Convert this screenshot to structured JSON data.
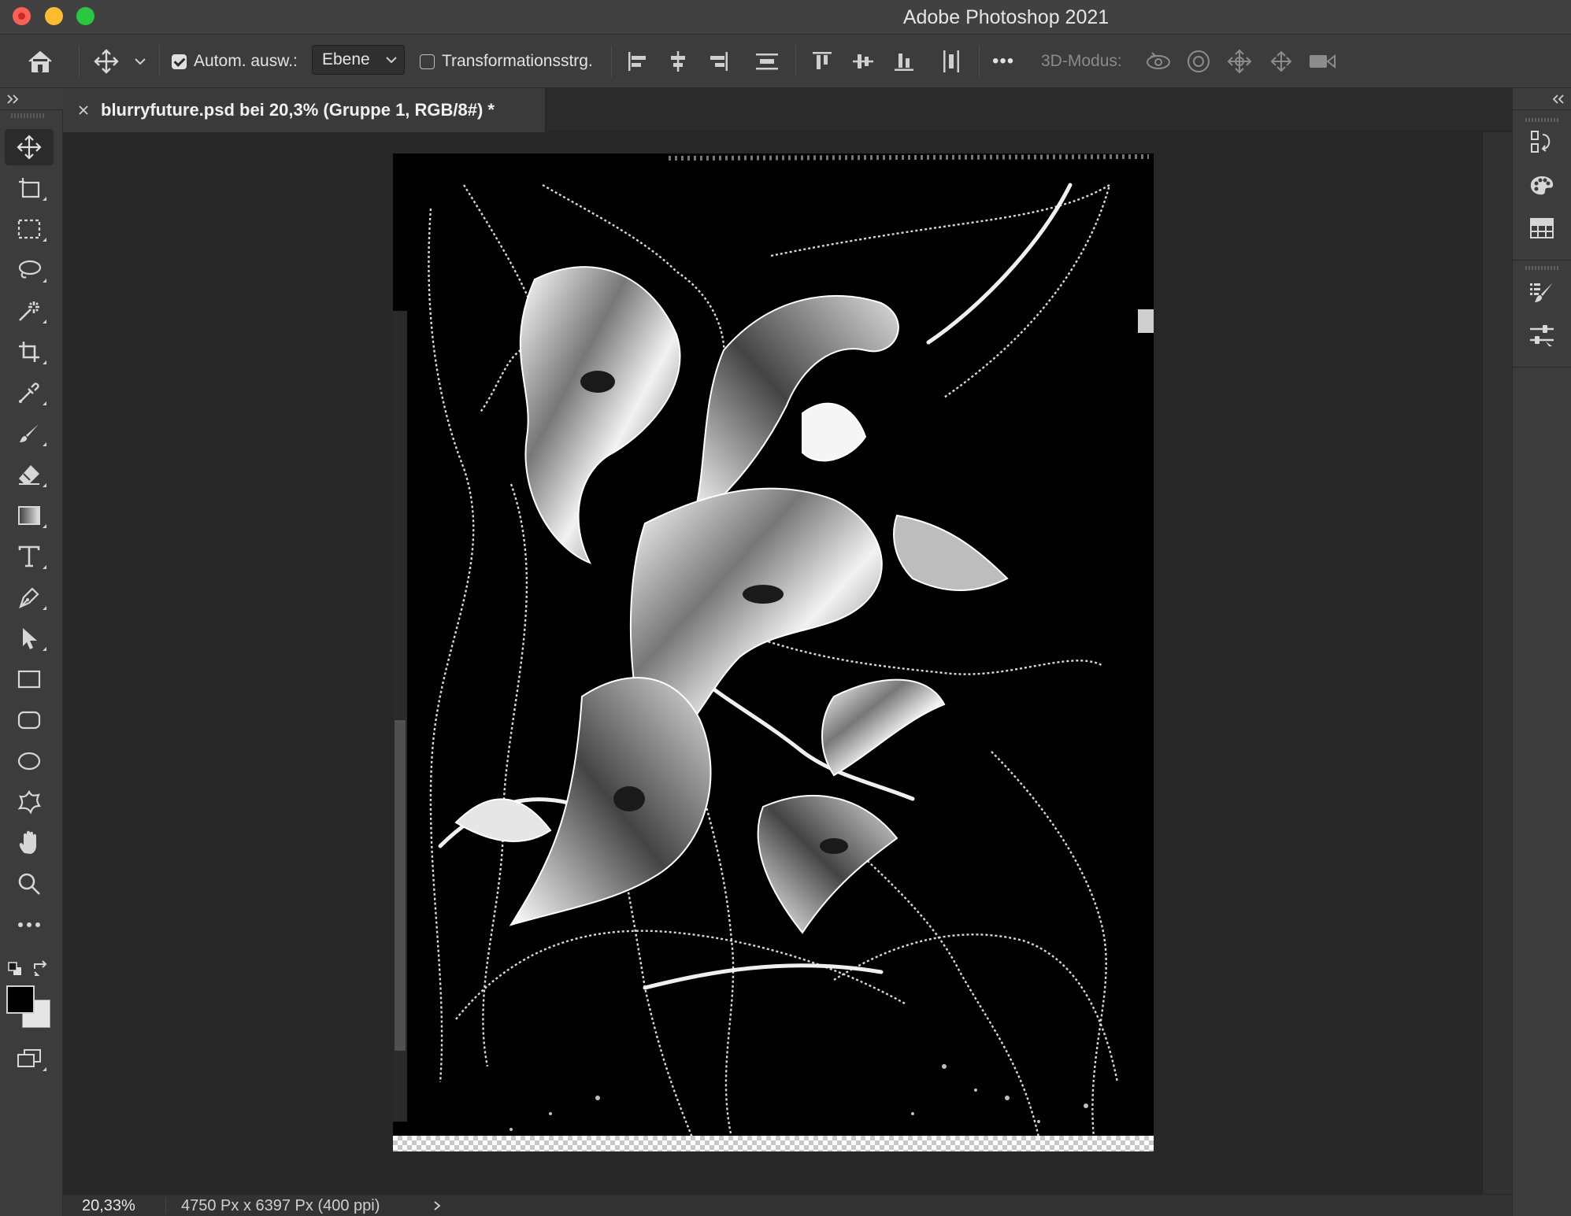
{
  "window": {
    "title": "Adobe Photoshop 2021"
  },
  "options_bar": {
    "auto_select_label": "Autom. ausw.:",
    "auto_select_checked": true,
    "auto_select_target": "Ebene",
    "transform_controls_label": "Transformationsstrg.",
    "transform_controls_checked": false,
    "more_label": "•••",
    "mode_3d_label": "3D-Modus:"
  },
  "document": {
    "tab_title": "blurryfuture.psd bei 20,3% (Gruppe 1, RGB/8#) *"
  },
  "tools": [
    {
      "name": "move-tool",
      "icon": "move-icon",
      "active": true
    },
    {
      "name": "artboard-tool",
      "icon": "artboard-icon"
    },
    {
      "name": "rectangular-marquee-tool",
      "icon": "marquee-icon"
    },
    {
      "name": "lasso-tool",
      "icon": "lasso-icon"
    },
    {
      "name": "magic-wand-tool",
      "icon": "magic-wand-icon"
    },
    {
      "name": "crop-tool",
      "icon": "crop-icon"
    },
    {
      "name": "eyedropper-tool",
      "icon": "eyedropper-icon"
    },
    {
      "name": "brush-tool",
      "icon": "brush-icon"
    },
    {
      "name": "eraser-tool",
      "icon": "eraser-icon"
    },
    {
      "name": "gradient-tool",
      "icon": "gradient-icon"
    },
    {
      "name": "type-tool",
      "icon": "type-icon"
    },
    {
      "name": "pen-tool",
      "icon": "pen-icon"
    },
    {
      "name": "path-selection-tool",
      "icon": "path-selection-icon"
    },
    {
      "name": "rectangle-tool",
      "icon": "rectangle-icon"
    },
    {
      "name": "rounded-rectangle-tool",
      "icon": "rounded-rectangle-icon"
    },
    {
      "name": "ellipse-tool",
      "icon": "ellipse-icon"
    },
    {
      "name": "custom-shape-tool",
      "icon": "custom-shape-icon"
    },
    {
      "name": "hand-tool",
      "icon": "hand-icon"
    },
    {
      "name": "zoom-tool",
      "icon": "zoom-icon"
    },
    {
      "name": "edit-toolbar",
      "icon": "more-icon"
    }
  ],
  "colors": {
    "foreground": "#000000",
    "background": "#e6e6e6",
    "accent": "#3c3c3c",
    "canvas_bg": "#282828"
  },
  "status_bar": {
    "zoom": "20,33%",
    "document_info": "4750 Px x 6397 Px (400 ppi)"
  },
  "right_dock": [
    {
      "name": "history-panel-button",
      "icon": "history-icon"
    },
    {
      "name": "swatches-panel-button",
      "icon": "palette-icon"
    },
    {
      "name": "grid-panel-button",
      "icon": "grid-icon"
    },
    {
      "name": "brush-settings-button",
      "icon": "brush-settings-icon"
    },
    {
      "name": "adjustments-button",
      "icon": "sliders-icon"
    }
  ]
}
